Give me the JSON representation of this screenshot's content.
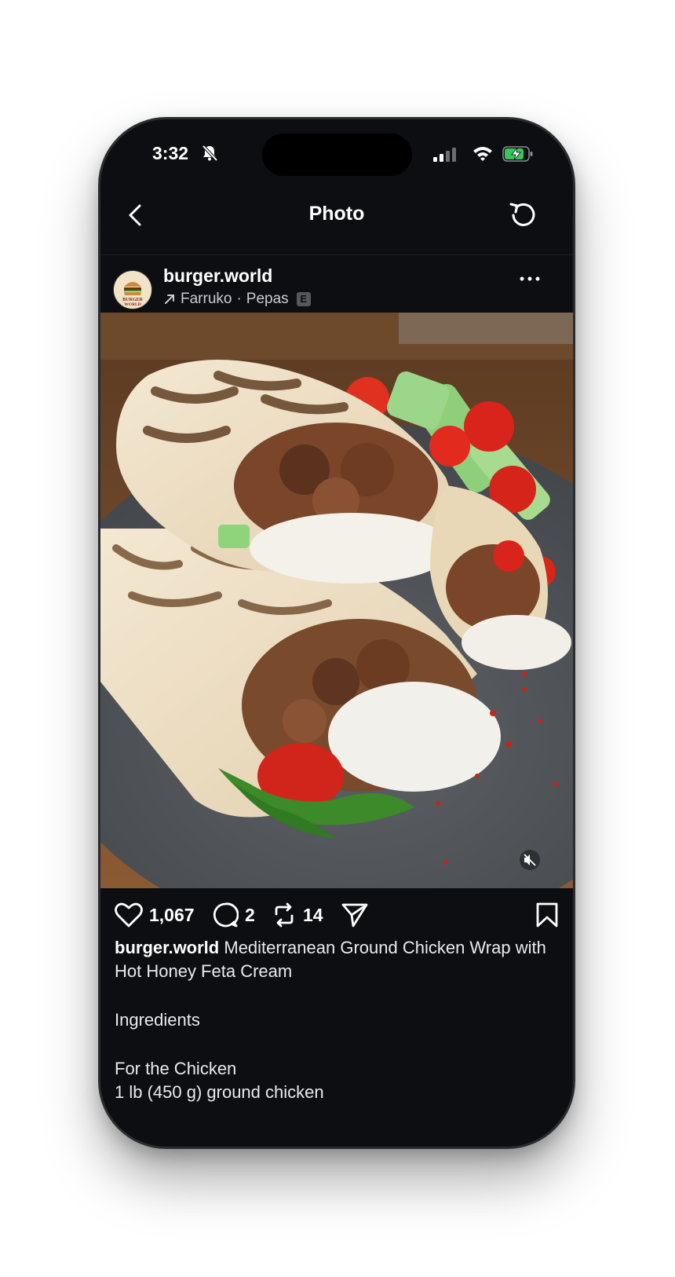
{
  "status_bar": {
    "time": "3:32"
  },
  "nav": {
    "title": "Photo"
  },
  "post": {
    "username": "burger.world",
    "avatar_text": "BURGER WORLD",
    "music_artist": "Farruko",
    "music_separator": "·",
    "music_song": "Pepas",
    "explicit_badge": "E",
    "likes": "1,067",
    "comments": "2",
    "reposts": "14"
  },
  "caption": {
    "username": "burger.world",
    "text": "Mediterranean Ground Chicken Wrap with Hot Honey Feta Cream",
    "line1": "Ingredients",
    "line2": "For the Chicken",
    "line3": "1 lb (450 g) ground chicken"
  },
  "colors": {
    "background": "#0c0e11",
    "text": "#ffffff"
  }
}
